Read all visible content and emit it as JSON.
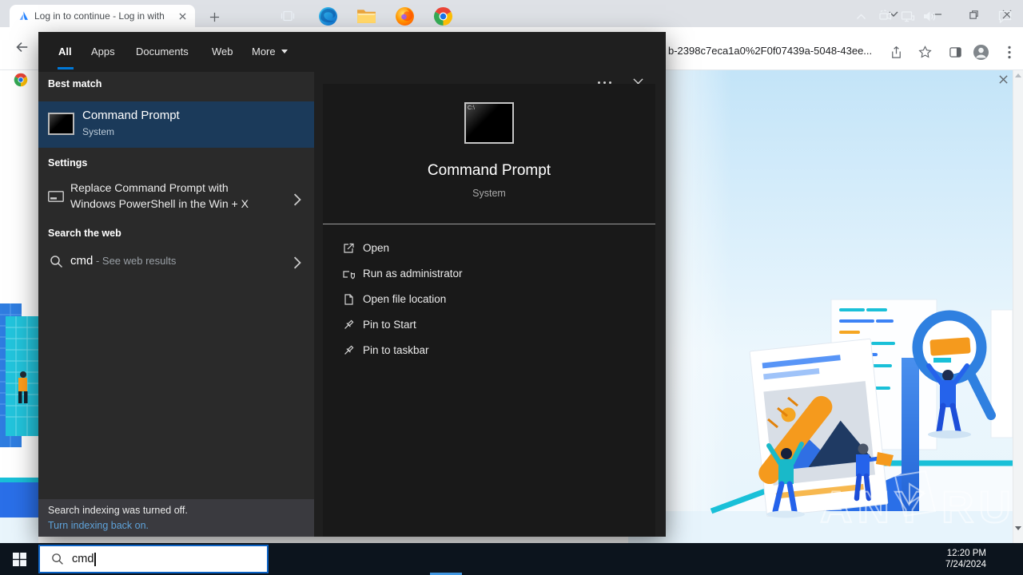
{
  "browser": {
    "tab_title": "Log in to continue - Log in with",
    "url_fragment": "b-2398c7eca1a0%2F0f07439a-5048-43ee..."
  },
  "search": {
    "tabs": [
      "All",
      "Apps",
      "Documents",
      "Web",
      "More"
    ],
    "sections": {
      "best_match_label": "Best match",
      "settings_label": "Settings",
      "web_label": "Search the web"
    },
    "best_match": {
      "title": "Command Prompt",
      "subtitle": "System"
    },
    "settings_item": {
      "line1": "Replace Command Prompt with",
      "line2": "Windows PowerShell in the Win + X"
    },
    "web_item": {
      "query": "cmd",
      "suffix": " - See web results"
    },
    "footer": {
      "line1": "Search indexing was turned off.",
      "link": "Turn indexing back on."
    },
    "detail": {
      "icon_label": "C:\\",
      "title": "Command Prompt",
      "subtitle": "System",
      "actions": [
        "Open",
        "Run as administrator",
        "Open file location",
        "Pin to Start",
        "Pin to taskbar"
      ]
    }
  },
  "taskbar": {
    "search_value": "cmd",
    "clock_time": "12:20 PM",
    "clock_date": "7/24/2024"
  },
  "watermark": {
    "left": "ANY",
    "right": "RUN"
  },
  "colors": {
    "accent": "#0078d7",
    "selection": "#1b3a5a",
    "link": "#5ea2d9",
    "taskbar": "#0c141d",
    "flyout_bg": "#1f1f1f"
  }
}
